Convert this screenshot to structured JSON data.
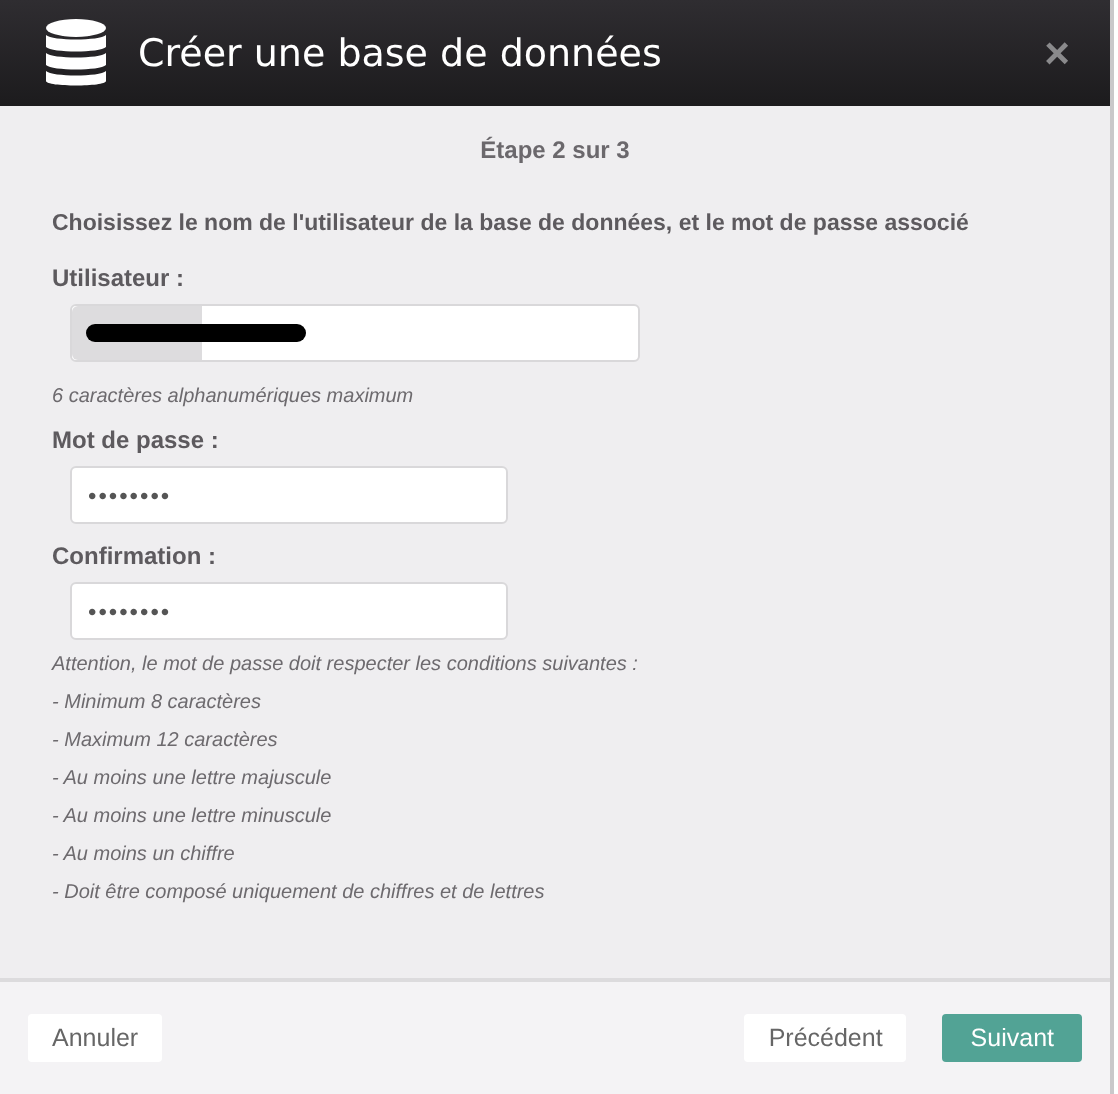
{
  "window": {
    "title": "Créer une base de données",
    "close": "×"
  },
  "step": "Étape 2 sur 3",
  "intro": "Choisissez le nom de l'utilisateur de la base de données, et le mot de passe associé",
  "fields": [
    {
      "kind": "prefixed",
      "label": "Utilisateur :",
      "redacted": true,
      "hint": "6 caractères alphanumériques maximum"
    },
    {
      "kind": "password",
      "label": "Mot de passe :",
      "value": "••••••••"
    },
    {
      "kind": "password",
      "label": "Confirmation :",
      "value": "••••••••"
    }
  ],
  "notes": [
    "Attention, le mot de passe doit respecter les conditions suivantes :",
    "- Minimum 8 caractères",
    "- Maximum 12 caractères",
    "- Au moins une lettre majuscule",
    "- Au moins une lettre minuscule",
    "- Au moins un chiffre",
    "- Doit être composé uniquement de chiffres et de lettres"
  ],
  "buttons": [
    {
      "label": "Annuler",
      "kind": "plain"
    },
    {
      "label": "Précédent",
      "kind": "plain"
    },
    {
      "label": "Suivant",
      "kind": "primary"
    }
  ]
}
